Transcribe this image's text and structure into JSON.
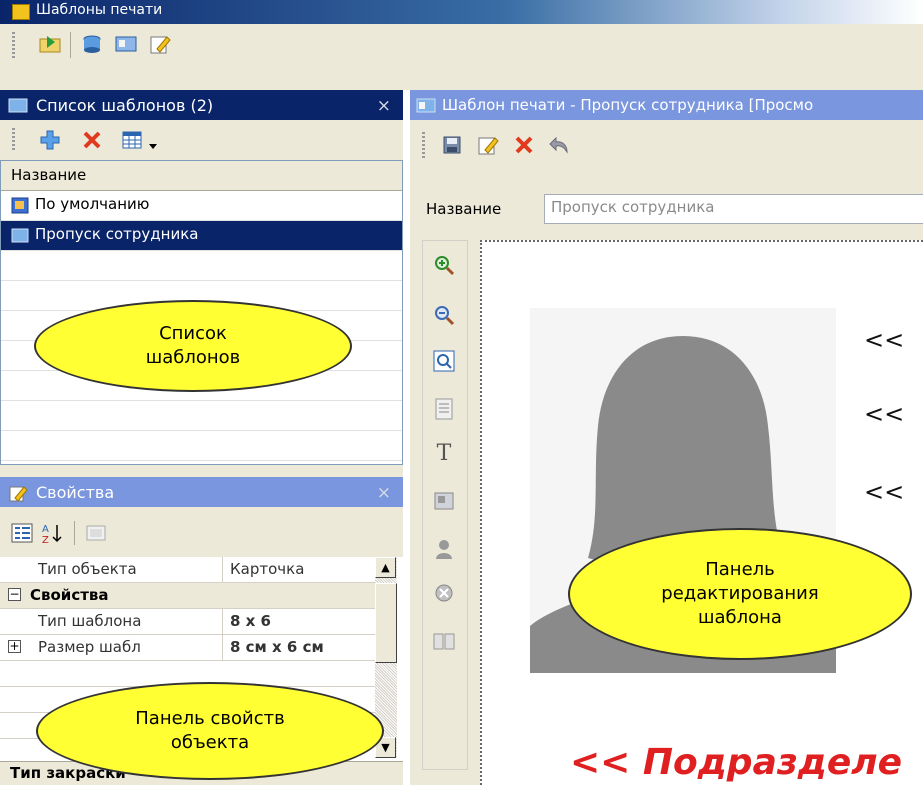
{
  "window": {
    "title": "Шаблоны печати"
  },
  "list_panel": {
    "title": "Список шаблонов (2)",
    "close_glyph": "×",
    "column_header": "Название",
    "items": [
      {
        "label": "По умолчанию",
        "selected": false
      },
      {
        "label": "Пропуск сотрудника",
        "selected": true
      }
    ]
  },
  "props_panel": {
    "title": "Свойства",
    "close_glyph": "×",
    "rows": [
      {
        "key": "Тип объекта",
        "value": "Карточка"
      },
      {
        "key": "Свойства"
      },
      {
        "key": "Тип шаблона",
        "value": "8 x 6"
      },
      {
        "key": "Размер шабл",
        "value": "8 см х 6 см"
      }
    ],
    "bottom_category": "Тип закраски"
  },
  "editor_panel": {
    "title": "Шаблон печати - Пропуск сотрудника [Просмо",
    "name_label": "Название",
    "name_value": "Пропуск сотрудника",
    "canvas": {
      "chevrons": [
        "<<",
        "<<",
        "<<"
      ],
      "department_text": "<< Подразделе"
    }
  },
  "callouts": {
    "list": "Список\nшаблонов",
    "editor": "Панель\nредактирования\nшаблона",
    "props": "Панель свойств\nобъекта"
  },
  "icons": {
    "toolbar": [
      "open-folder-icon",
      "database-icon",
      "card-icon",
      "edit-icon"
    ],
    "list_toolbar": [
      "add-icon",
      "delete-icon",
      "view-grid-icon",
      "dropdown-arrow-icon"
    ],
    "props_toolbar": [
      "categorized-icon",
      "sort-alpha-icon",
      "property-pages-icon"
    ],
    "editor_toolbar": [
      "save-icon",
      "edit-icon",
      "delete-icon",
      "undo-icon"
    ],
    "side_tools": [
      "zoom-in-icon",
      "zoom-out-icon",
      "zoom-fit-icon",
      "text-block-icon",
      "text-tool-icon",
      "image-tool-icon",
      "person-photo-icon",
      "barcode-icon",
      "book-icon"
    ]
  },
  "colors": {
    "selection": "#0a246a",
    "callout": "#ffff33",
    "department_text": "#e02020"
  }
}
